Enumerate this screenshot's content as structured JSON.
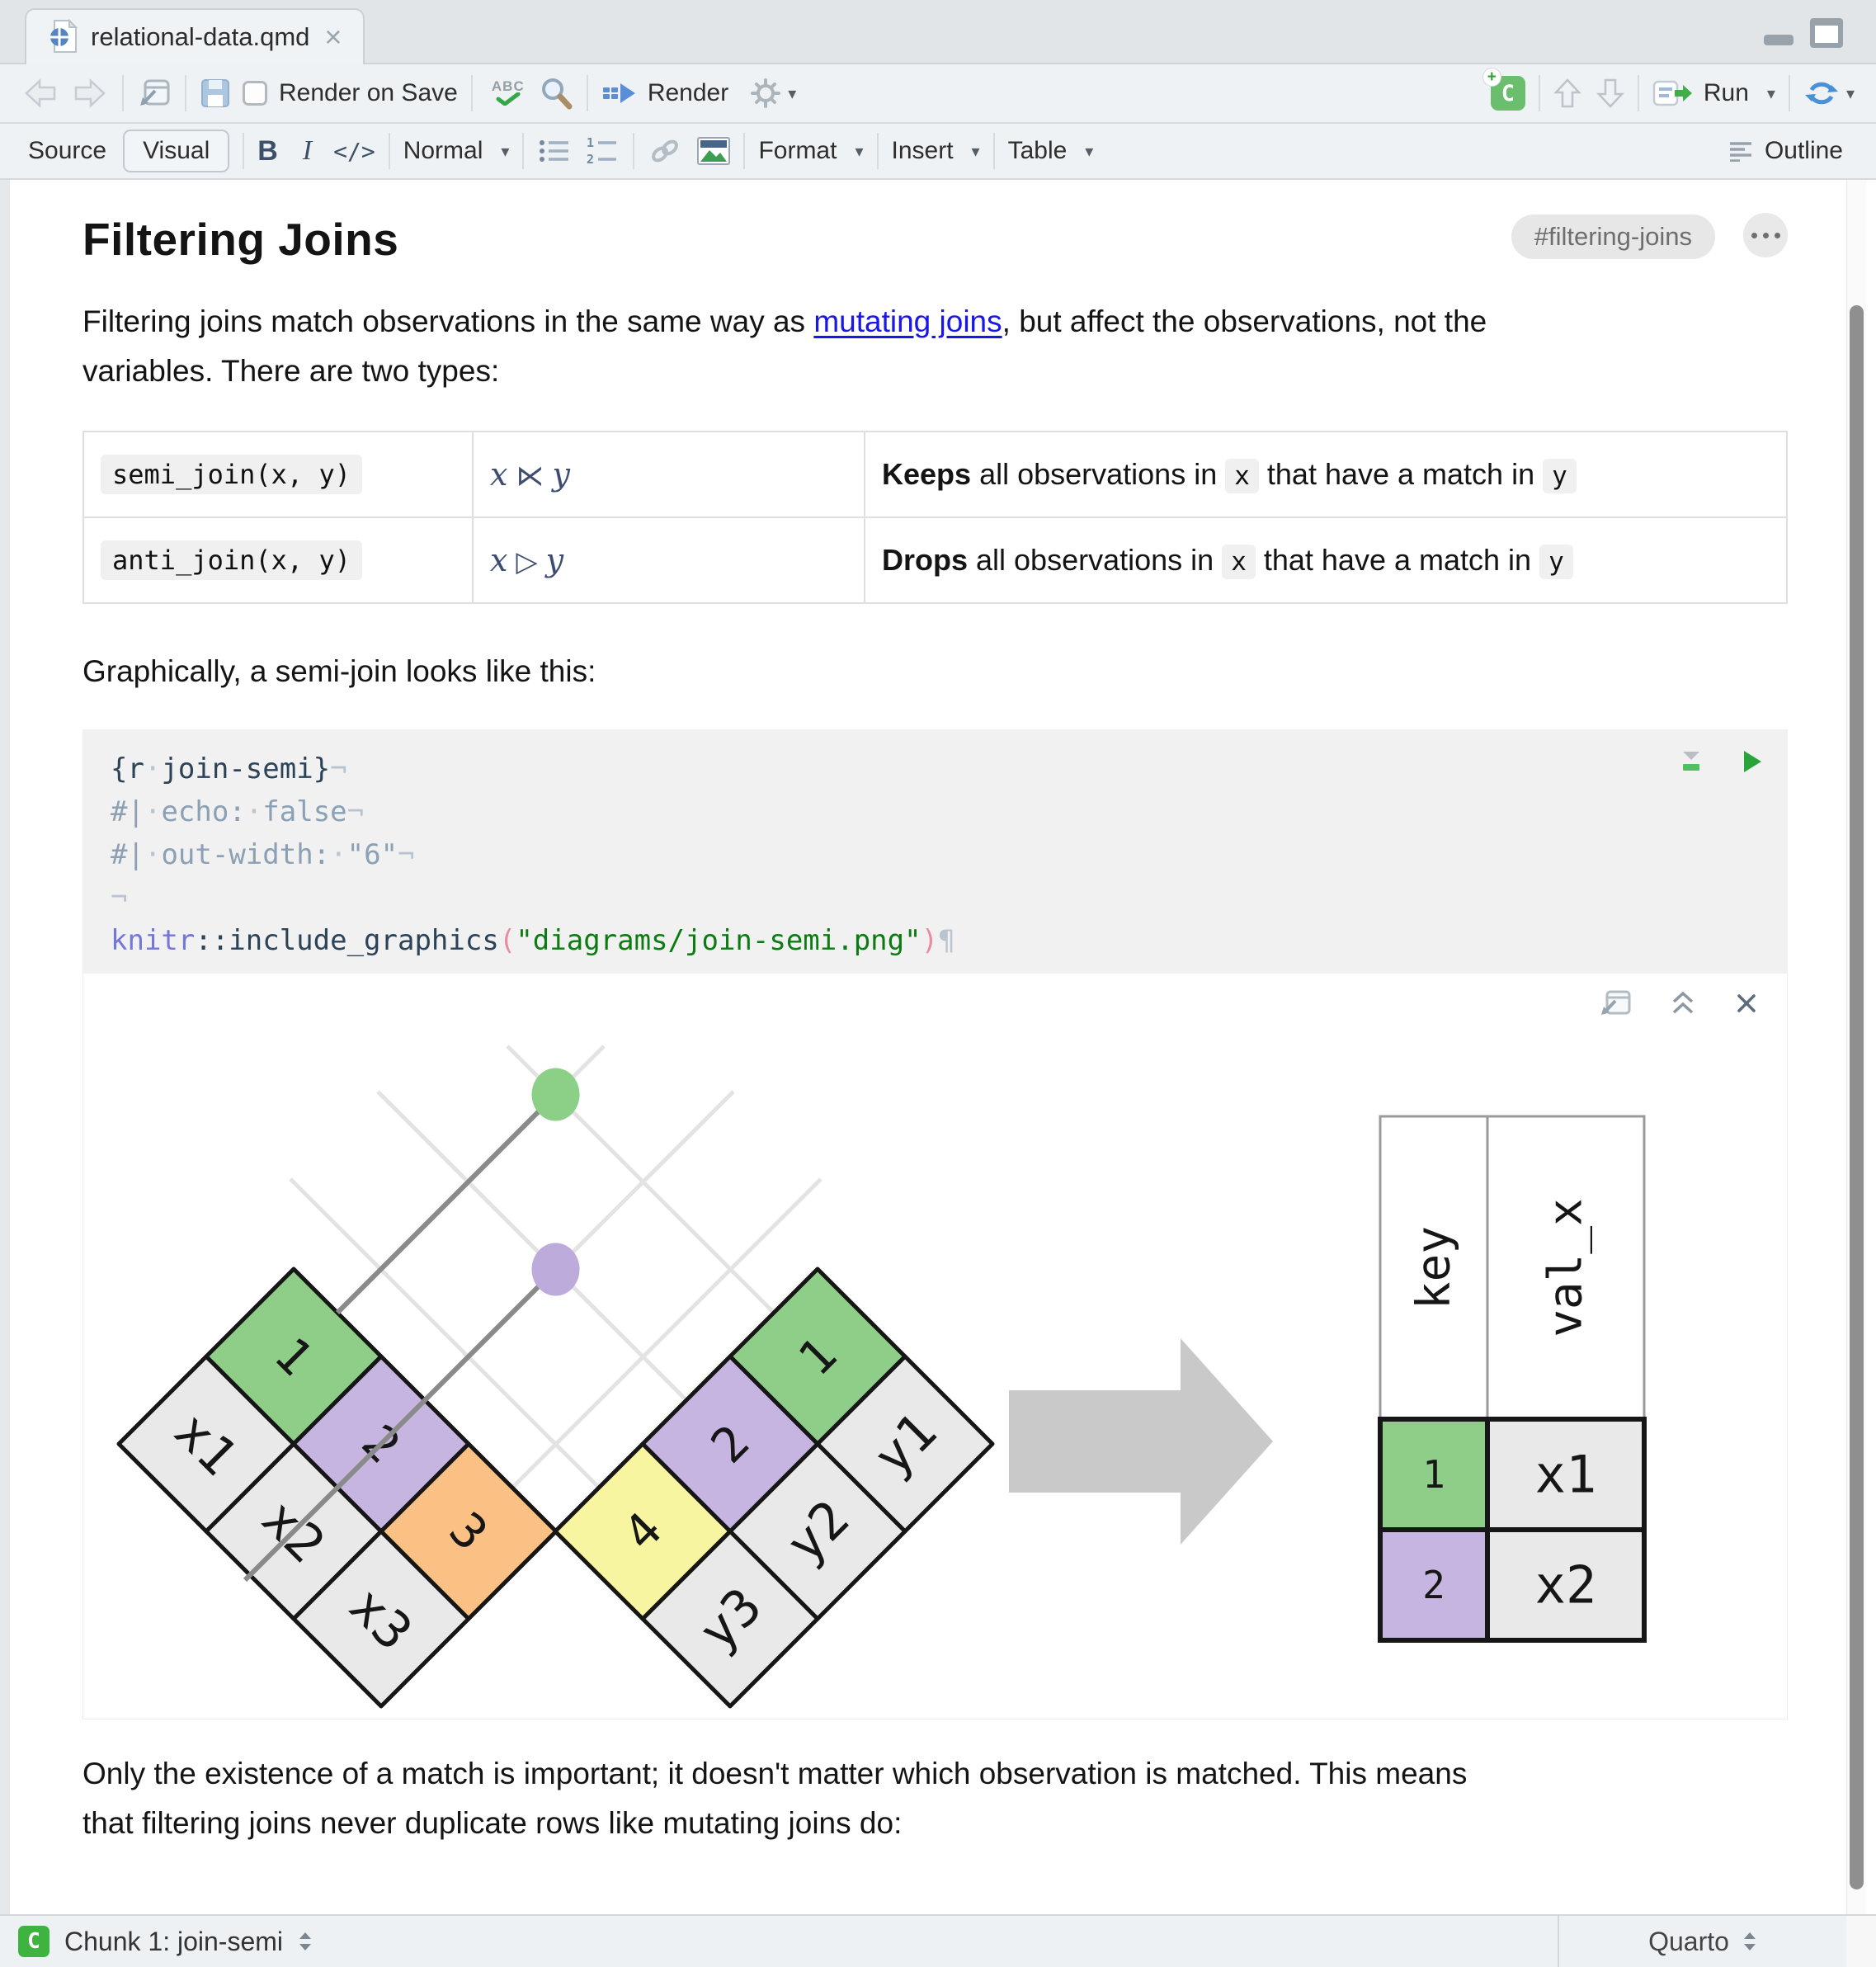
{
  "tab": {
    "title": "relational-data.qmd",
    "close": "×"
  },
  "toolbar": {
    "render_on_save": "Render on Save",
    "spellcheck": "ABC",
    "render": "Render",
    "run": "Run"
  },
  "format_bar": {
    "source": "Source",
    "visual": "Visual",
    "bold": "B",
    "italic": "I",
    "code_inline": "</>",
    "style": "Normal",
    "format": "Format",
    "insert": "Insert",
    "table": "Table",
    "outline": "Outline"
  },
  "document": {
    "heading": "Filtering Joins",
    "anchor_badge": "#filtering-joins",
    "intro": {
      "before_link": "Filtering joins match observations in the same way as ",
      "link": "mutating joins",
      "after_link": ", but affect the observations, not the",
      "line2": "variables. There are two types:"
    },
    "join_table": {
      "rows": [
        {
          "code": "semi_join(x, y)",
          "math": {
            "left": "x",
            "op": "⋉",
            "right": "y"
          },
          "desc": {
            "bold": "Keeps",
            "mid1": " all observations in ",
            "code1": "x",
            "mid2": " that have a match in ",
            "code2": "y"
          }
        },
        {
          "code": "anti_join(x, y)",
          "math": {
            "left": "x",
            "op": "▷",
            "right": "y"
          },
          "desc": {
            "bold": "Drops",
            "mid1": " all observations in ",
            "code1": "x",
            "mid2": " that have a match in ",
            "code2": "y"
          }
        }
      ]
    },
    "graphically": "Graphically, a semi-join looks like this:",
    "chunk": {
      "lines": [
        [
          {
            "t": "{r",
            "c": "plain"
          },
          {
            "t": "·",
            "c": "ws"
          },
          {
            "t": "join-semi}",
            "c": "plain"
          },
          {
            "t": "¬",
            "c": "ws"
          }
        ],
        [
          {
            "t": "#|",
            "c": "meta"
          },
          {
            "t": "·",
            "c": "ws"
          },
          {
            "t": "echo:",
            "c": "meta"
          },
          {
            "t": "·",
            "c": "ws"
          },
          {
            "t": "false",
            "c": "meta"
          },
          {
            "t": "¬",
            "c": "ws"
          }
        ],
        [
          {
            "t": "#|",
            "c": "meta"
          },
          {
            "t": "·",
            "c": "ws"
          },
          {
            "t": "out-width:",
            "c": "meta"
          },
          {
            "t": "·",
            "c": "ws"
          },
          {
            "t": "\"6\"",
            "c": "meta"
          },
          {
            "t": "¬",
            "c": "ws"
          }
        ],
        [
          {
            "t": "¬",
            "c": "ws"
          }
        ],
        [
          {
            "t": "knitr",
            "c": "ns"
          },
          {
            "t": "::include_graphics",
            "c": "plain"
          },
          {
            "t": "(",
            "c": "paren"
          },
          {
            "t": "\"diagrams/join-semi.png\"",
            "c": "str"
          },
          {
            "t": ")",
            "c": "paren"
          },
          {
            "t": "¶",
            "c": "ws"
          }
        ]
      ]
    },
    "outro": {
      "line1": "Only the existence of a match is important; it doesn't matter which observation is matched. This means",
      "line2": "that filtering joins never duplicate rows like mutating joins do:"
    }
  },
  "diagram": {
    "x_table": {
      "keys": [
        {
          "label": "1",
          "color": "#8ECE88"
        },
        {
          "label": "2",
          "color": "#C6B5E0"
        },
        {
          "label": "3",
          "color": "#FBC083"
        }
      ],
      "values": [
        "x1",
        "x2",
        "x3"
      ],
      "value_color": "#E9E9E9"
    },
    "y_table": {
      "keys": [
        {
          "label": "1",
          "color": "#8ECE88"
        },
        {
          "label": "2",
          "color": "#C6B5E0"
        },
        {
          "label": "4",
          "color": "#F8F5A0"
        }
      ],
      "values": [
        "y1",
        "y2",
        "y3"
      ],
      "value_color": "#E9E9E9"
    },
    "matches": [
      {
        "x_index": 0,
        "y_index": 0,
        "dot_color": "#8CCF87",
        "through_table": false
      },
      {
        "x_index": 1,
        "y_index": 1,
        "dot_color": "#BCABDB",
        "through_table": true
      }
    ],
    "result_table": {
      "headers": [
        "key",
        "val_x"
      ],
      "rows": [
        {
          "key": "1",
          "key_color": "#8ECE88",
          "val": "x1"
        },
        {
          "key": "2",
          "key_color": "#C6B5E0",
          "val": "x2"
        }
      ],
      "val_color": "#E9E9E9"
    },
    "colors": {
      "light_line": "#e3e3e3",
      "dark_line": "#8a8a8a",
      "cell_border": "#161616",
      "arrow": "#c9c9c9",
      "header_border": "#9a9a9a"
    }
  },
  "status_bar": {
    "chunk_label": "Chunk 1: join-semi",
    "mode": "Quarto"
  }
}
